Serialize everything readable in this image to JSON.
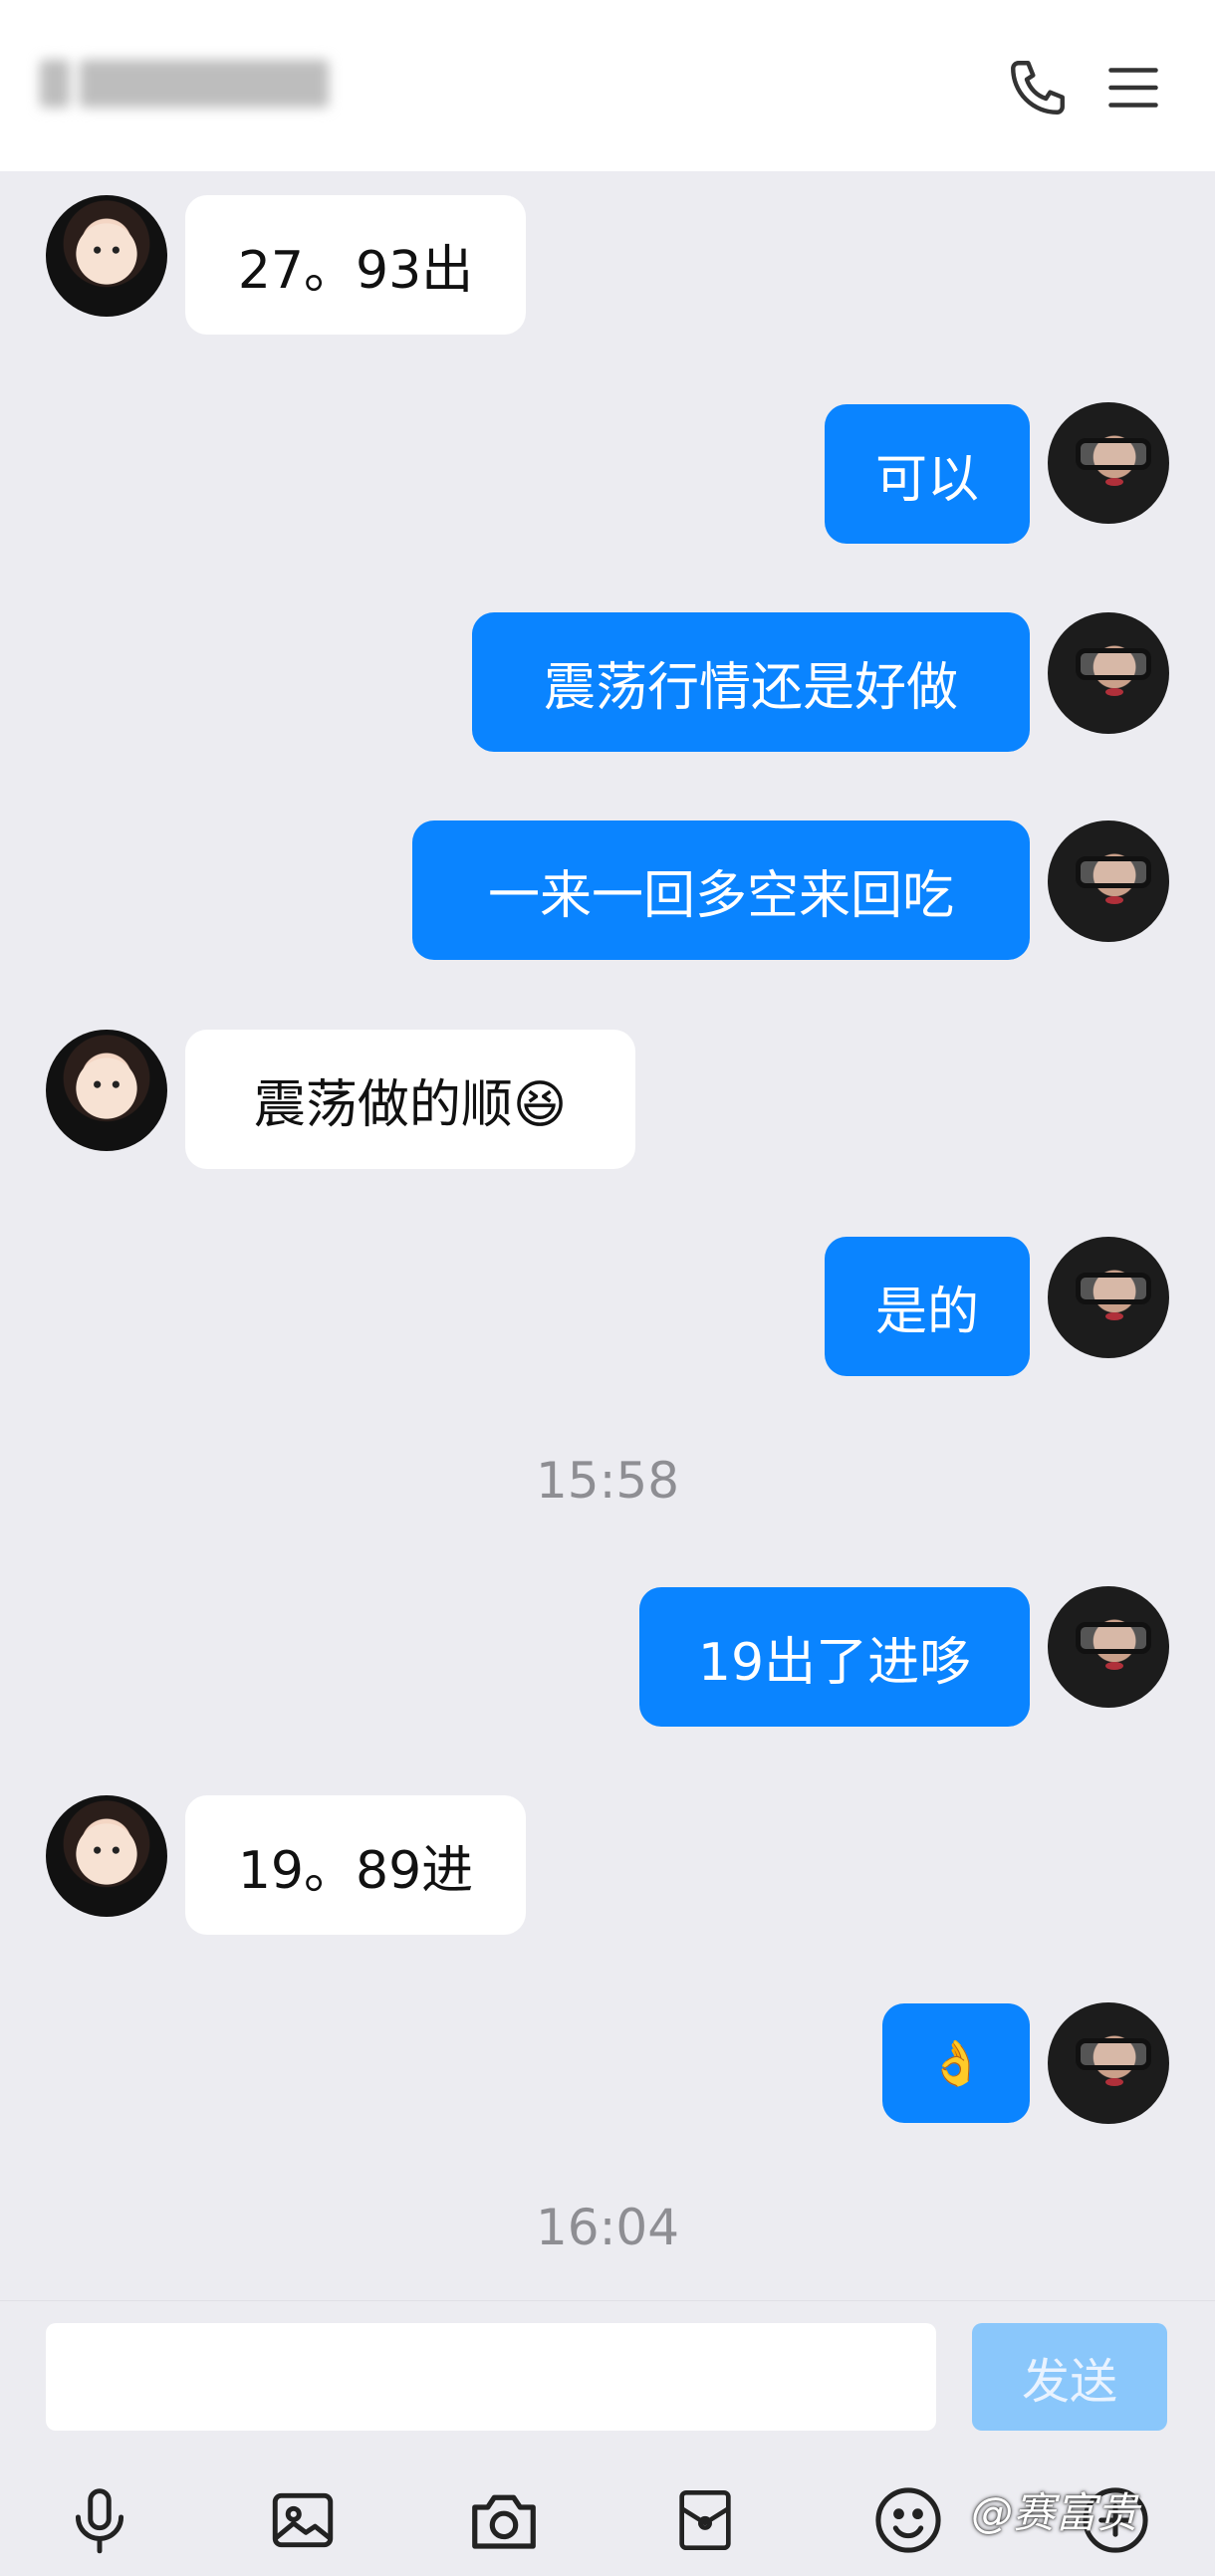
{
  "header": {
    "contact_name": "",
    "phone_icon": "phone-icon",
    "menu_icon": "hamburger-menu-icon"
  },
  "messages": [
    {
      "side": "in",
      "text": "27。93出"
    },
    {
      "side": "out",
      "text": "可以"
    },
    {
      "side": "out",
      "text": "震荡行情还是好做"
    },
    {
      "side": "out",
      "text": "一来一回多空来回吃"
    },
    {
      "side": "in",
      "text": "震荡做的顺😆"
    },
    {
      "side": "out",
      "text": "是的"
    },
    {
      "type": "time",
      "text": "15:58"
    },
    {
      "side": "out",
      "text": "19出了进哆"
    },
    {
      "side": "in",
      "text": "19。89进"
    },
    {
      "side": "out",
      "text": "👌"
    },
    {
      "type": "time",
      "text": "16:04"
    }
  ],
  "composer": {
    "input_value": "",
    "send_label": "发送"
  },
  "toolbar": {
    "icons": [
      "microphone-icon",
      "image-icon",
      "camera-icon",
      "red-packet-icon",
      "emoji-icon",
      "plus-icon"
    ]
  },
  "watermark": "@赛富贵",
  "colors": {
    "outgoing_bubble": "#0a84ff",
    "incoming_bubble": "#ffffff",
    "background": "#ececf1",
    "send_button": "#8ac7fb"
  }
}
